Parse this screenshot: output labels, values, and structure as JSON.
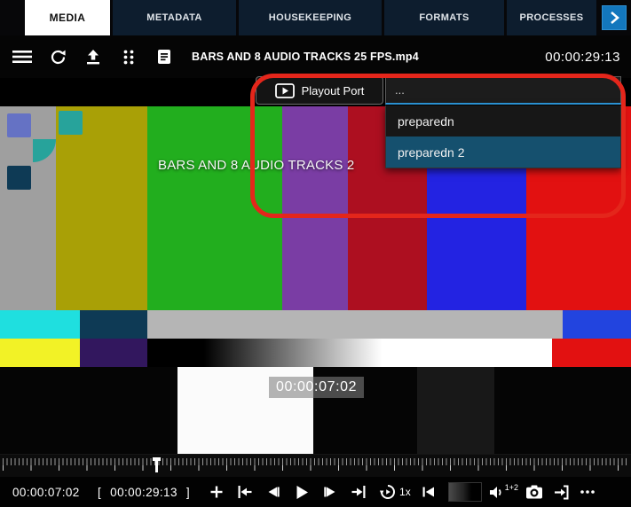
{
  "tabs": {
    "items": [
      {
        "label": "MEDIA",
        "active": true
      },
      {
        "label": "METADATA",
        "active": false
      },
      {
        "label": "HOUSEKEEPING",
        "active": false
      },
      {
        "label": "FORMATS",
        "active": false
      },
      {
        "label": "PROCESSES",
        "active": false
      }
    ]
  },
  "toolbar": {
    "filename": "BARS AND 8 AUDIO TRACKS 25 FPS.mp4",
    "duration": "00:00:29:13"
  },
  "playout": {
    "button_label": "Playout Port",
    "combo_value": "...",
    "options": [
      {
        "label": "preparedn",
        "selected": false
      },
      {
        "label": "preparedn 2",
        "selected": true
      }
    ]
  },
  "video": {
    "title_overlay": "BARS AND 8 AUDIO TRACKS 2",
    "burnin_timecode": "00:00:07:02"
  },
  "transport": {
    "current_timecode": "00:00:07:02",
    "bracket_open": "[",
    "total_timecode": "00:00:29:13",
    "bracket_close": "]",
    "speed_label": "1x",
    "audio_channels_label": "1+2"
  },
  "icons": {
    "tab_scroll": "chevron-right",
    "menu": "hamburger",
    "refresh": "circular-arrow",
    "upload": "arrow-up-tray",
    "grid": "dots-grid",
    "file": "document",
    "playout": "play-monitor",
    "add": "plus",
    "mark_in": "arrow-to-bar-left",
    "step_back": "frame-back",
    "play": "play-triangle",
    "step_forward": "frame-forward",
    "mark_out": "arrow-to-bar-right",
    "loop_speed": "replay-circle",
    "skip_start": "skip-to-start",
    "volume": "speaker",
    "camera": "snapshot-camera",
    "export": "export-arrow",
    "more": "ellipsis"
  },
  "colors": {
    "accent_blue": "#1377bd",
    "selection_blue": "#15506e",
    "combo_underline_blue": "#2f9be0",
    "annotation_red": "#e4261b",
    "active_tab_bg": "#ffffff",
    "tab_bg": "#0d1d2e"
  }
}
